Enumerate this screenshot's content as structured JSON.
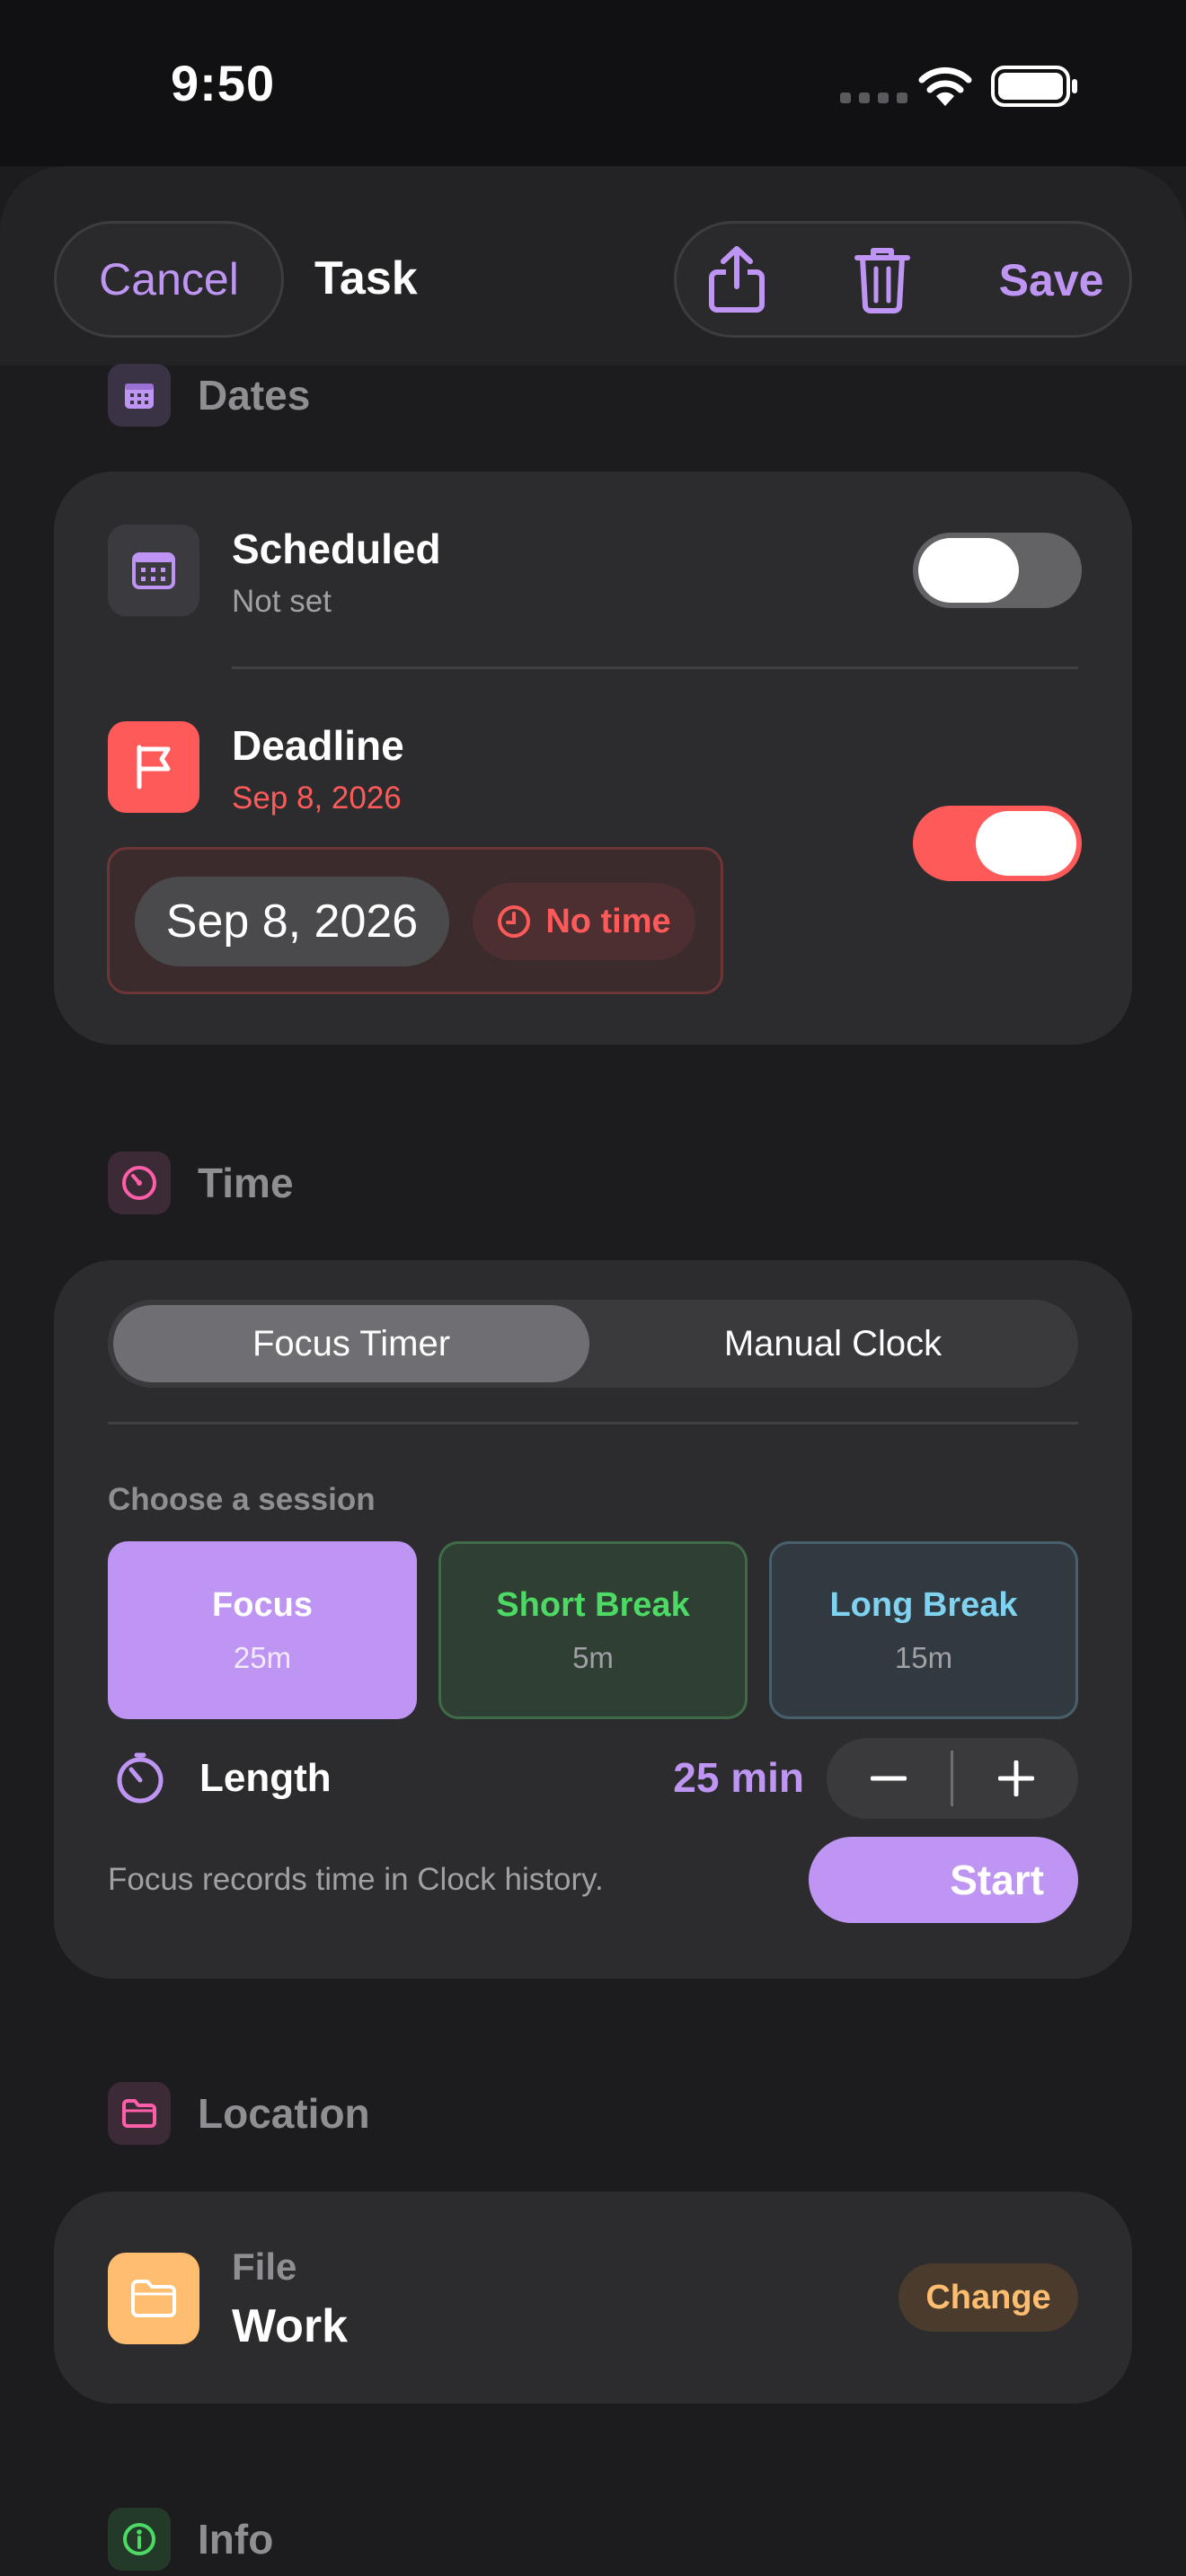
{
  "status_bar": {
    "time": "9:50"
  },
  "nav": {
    "cancel_label": "Cancel",
    "title": "Task",
    "save_label": "Save"
  },
  "dates": {
    "section_label": "Dates",
    "scheduled": {
      "title": "Scheduled",
      "value": "Not set",
      "enabled": false
    },
    "deadline": {
      "title": "Deadline",
      "value": "Sep 8, 2026",
      "enabled": true,
      "date_chip": "Sep 8, 2026",
      "time_chip": "No time"
    }
  },
  "time": {
    "section_label": "Time",
    "modes": [
      {
        "label": "Focus Timer",
        "selected": true
      },
      {
        "label": "Manual Clock",
        "selected": false
      }
    ],
    "session_prompt": "Choose a session",
    "sessions": [
      {
        "name": "Focus",
        "duration": "25m",
        "selected": true
      },
      {
        "name": "Short Break",
        "duration": "5m",
        "selected": false
      },
      {
        "name": "Long Break",
        "duration": "15m",
        "selected": false
      }
    ],
    "length_label": "Length",
    "length_value": "25 min",
    "footnote": "Focus records time in Clock history.",
    "start_label": "Start"
  },
  "location": {
    "section_label": "Location",
    "file_label": "File",
    "file_value": "Work",
    "change_label": "Change"
  },
  "info": {
    "section_label": "Info"
  },
  "colors": {
    "accent": "#bf95f4",
    "deadline_red": "#ff5a5a",
    "short_break_green": "#4cd964",
    "long_break_cyan": "#7fd3f0",
    "folder_orange": "#ffbd70",
    "info_green": "#4cd964",
    "time_pink": "#ff5fa8"
  }
}
